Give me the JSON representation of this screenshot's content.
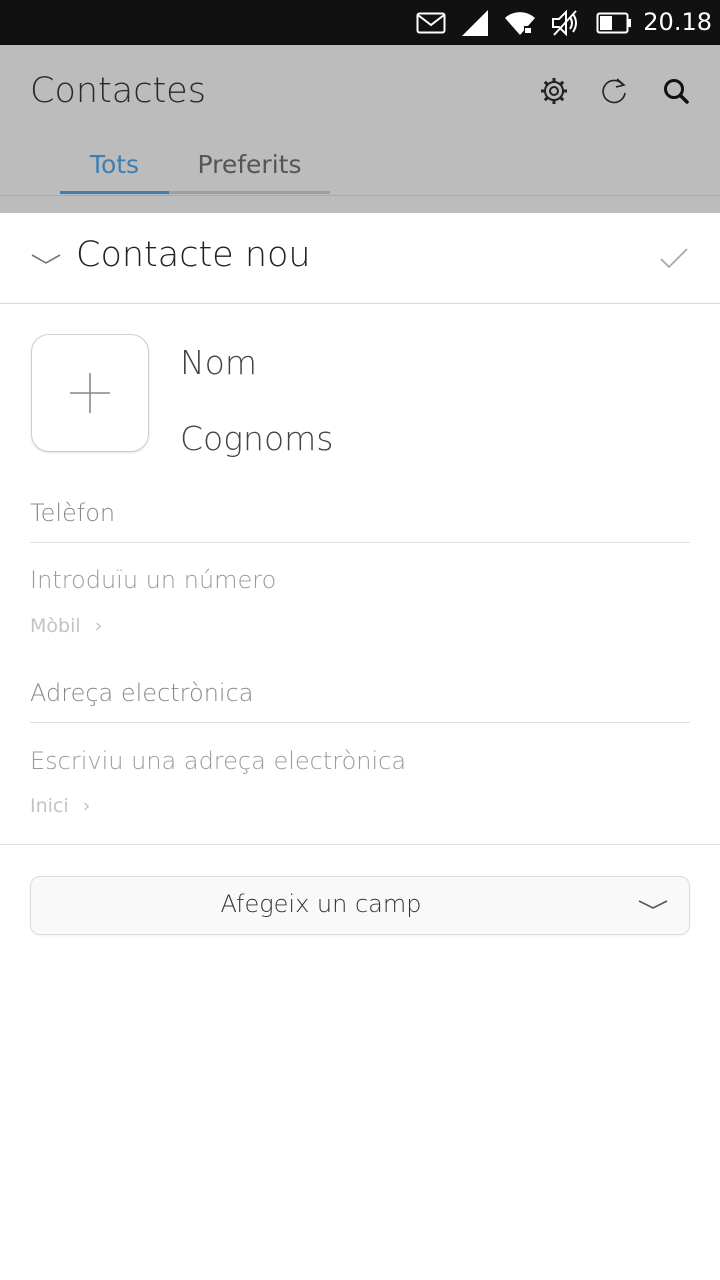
{
  "status_bar": {
    "time": "20.18",
    "icons": [
      "mail-icon",
      "signal-icon",
      "wifi-icon",
      "muted-speaker-icon",
      "battery-icon"
    ]
  },
  "header": {
    "title": "Contactes",
    "actions": [
      "settings-icon",
      "refresh-icon",
      "search-icon"
    ],
    "tabs": [
      {
        "label": "Tots",
        "active": true
      },
      {
        "label": "Preferits",
        "active": false
      }
    ]
  },
  "sheet": {
    "title": "Contacte nou"
  },
  "form": {
    "first_name_placeholder": "Nom",
    "last_name_placeholder": "Cognoms",
    "phone": {
      "label": "Telèfon",
      "placeholder": "Introduïu un número",
      "type": "Mòbil",
      "type_chevron": "›"
    },
    "email": {
      "label": "Adreça electrònica",
      "placeholder": "Escriviu una adreça electrònica",
      "type": "Inici",
      "type_chevron": "›"
    },
    "add_field_label": "Afegeix un camp"
  },
  "colors": {
    "accent": "#3d7fb3",
    "header_bg": "#bcbcbc",
    "status_bar_bg": "#111111"
  }
}
